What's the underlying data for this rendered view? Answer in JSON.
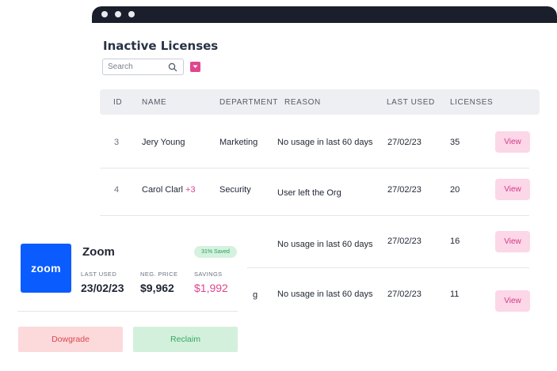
{
  "page": {
    "title": "Inactive Licenses",
    "search": {
      "placeholder": "Search",
      "value": ""
    }
  },
  "table": {
    "headers": [
      "ID",
      "NAME",
      "DEPARTMENT",
      "REASON",
      "LAST USED",
      "LICENSES"
    ],
    "view_label": "View",
    "rows": [
      {
        "id": "3",
        "name": "Jery Young",
        "extra": "",
        "department": "Marketing",
        "reason": "No usage in last 60 days",
        "last_used": "27/02/23",
        "licenses": "35"
      },
      {
        "id": "4",
        "name": "Carol Clarl",
        "extra": "+3",
        "department": "Security",
        "reason": "User left the Org",
        "last_used": "27/02/23",
        "licenses": "20"
      },
      {
        "id": "",
        "name": "",
        "extra": "",
        "department": "",
        "reason": "No usage in last 60 days",
        "last_used": "27/02/23",
        "licenses": "16"
      },
      {
        "id": "",
        "name": "",
        "extra": "",
        "department": "g",
        "reason": "No usage in last 60 days",
        "last_used": "27/02/23",
        "licenses": "11"
      }
    ]
  },
  "card": {
    "logo_text": "zoom",
    "title": "Zoom",
    "badge": "31% Saved",
    "last_used_label": "LAST USED",
    "last_used_value": "23/02/23",
    "neg_price_label": "NEG. PRICE",
    "neg_price_value": "$9,962",
    "savings_label": "SAVINGS",
    "savings_value": "$1,992",
    "downgrade_label": "Dowgrade",
    "reclaim_label": "Reclaim"
  },
  "colors": {
    "accent": "#e0468f",
    "titlebar": "#1b1f2b",
    "zoom_blue": "#0b5cff",
    "downgrade_bg": "#fcd9db",
    "reclaim_bg": "#d3f0dc"
  }
}
